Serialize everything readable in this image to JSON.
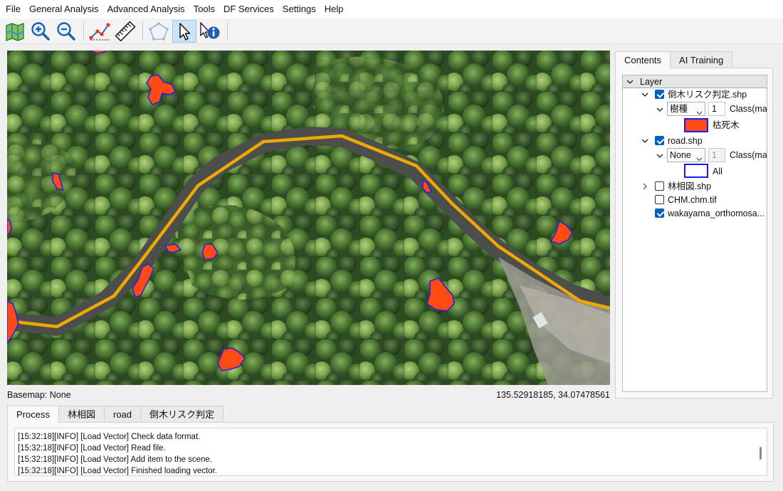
{
  "menu": [
    "File",
    "General Analysis",
    "Advanced Analysis",
    "Tools",
    "DF Services",
    "Settings",
    "Help"
  ],
  "toolbar": {
    "tools": [
      {
        "name": "basemap-map-icon",
        "active": false
      },
      {
        "name": "zoom-in-icon",
        "active": false
      },
      {
        "name": "zoom-out-icon",
        "active": false
      },
      {
        "name": "measure-polyline-icon",
        "active": false
      },
      {
        "name": "ruler-icon",
        "active": false
      },
      {
        "name": "polygon-draw-icon",
        "active": false
      },
      {
        "name": "select-pointer-icon",
        "active": true
      },
      {
        "name": "identify-info-icon",
        "active": false
      }
    ]
  },
  "colors": {
    "road_line": "#f0a800",
    "dead_tree_fill": "#ff4a12",
    "dead_tree_outline": "#2a20e0",
    "checkbox_checked": "#0060c0"
  },
  "status": {
    "basemap": "Basemap: None",
    "coordinates": "135.52918185, 34.07478561"
  },
  "right_panel": {
    "tabs": [
      "Contents",
      "AI Training"
    ],
    "active_tab": "Contents",
    "tree": {
      "root": "Layer",
      "layers": {
        "l1": {
          "label": "倒木リスク判定.shp",
          "checked": true,
          "field": "樹種",
          "class_value": "1",
          "class_label": "Class(max",
          "legend_label": "枯死木"
        },
        "l2": {
          "label": "road.shp",
          "checked": true,
          "field": "None",
          "class_value": "1",
          "class_label": "Class(max",
          "legend_label": "All"
        },
        "l3": {
          "label": "林相図.shp",
          "checked": false
        },
        "l4": {
          "label": "CHM.chm.tif",
          "checked": false
        },
        "l5": {
          "label": "wakayama_orthomosa...",
          "checked": true
        }
      }
    }
  },
  "bottom_panel": {
    "tabs": [
      "Process",
      "林相図",
      "road",
      "倒木リスク判定"
    ],
    "active_tab": "Process",
    "log": [
      "[15:32:18][INFO] [Load Vector] Check data format.",
      "[15:32:18][INFO] [Load Vector] Read file.",
      "[15:32:18][INFO] [Load Vector] Add item to the scene.",
      "[15:32:18][INFO] [Load Vector] Finished loading vector."
    ]
  }
}
